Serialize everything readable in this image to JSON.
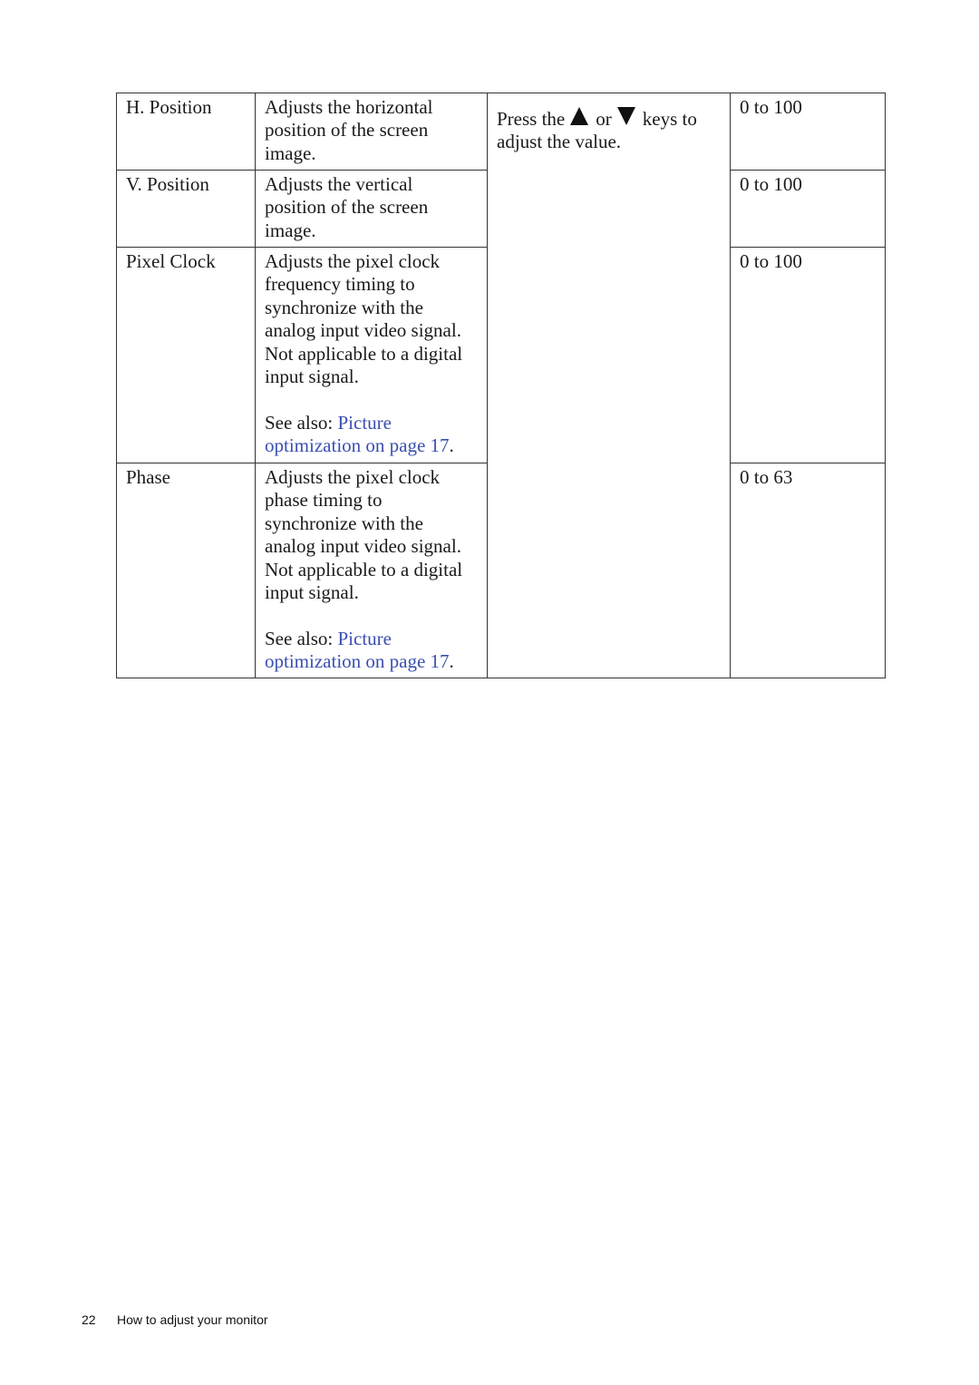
{
  "rows": [
    {
      "name": "H. Position",
      "desc": [
        "Adjusts the horizontal",
        "position of the screen",
        "image."
      ],
      "range": "0 to 100"
    },
    {
      "name": "V. Position",
      "desc": [
        "Adjusts the vertical",
        "position of the screen",
        "image."
      ],
      "range": "0 to 100"
    },
    {
      "name": "Pixel Clock",
      "desc": [
        "Adjusts the pixel clock",
        "frequency timing to",
        "synchronize with the",
        "analog input video signal.",
        "Not applicable to a digital",
        "input signal."
      ],
      "see_also": "See also: ",
      "link_1": "Picture",
      "link_2": "optimization on page 17",
      "period": ".",
      "range": "0 to 100"
    },
    {
      "name": "Phase",
      "desc": [
        "Adjusts the pixel clock",
        "phase timing to",
        "synchronize with the",
        "analog input video signal.",
        "Not applicable to a digital",
        "input signal."
      ],
      "see_also": "See also: ",
      "link_1": "Picture",
      "link_2": "optimization on page 17",
      "period": ".",
      "range": "0 to 63"
    }
  ],
  "operation": {
    "press": "Press the",
    "or": "or",
    "keys_to": "keys to",
    "line2": "adjust the value.",
    "up_icon": "triangle-up-icon",
    "down_icon": "triangle-down-icon"
  },
  "footer": {
    "page_number": "22",
    "section": "How to adjust your monitor"
  },
  "colors": {
    "link": "#3a4fb0",
    "text": "#1a1a1a"
  }
}
